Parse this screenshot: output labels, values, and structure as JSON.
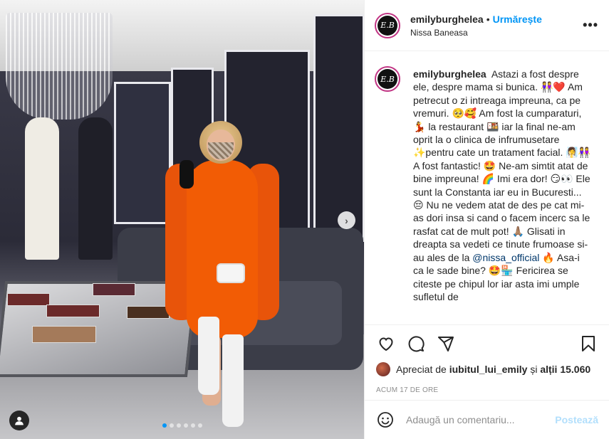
{
  "post": {
    "username": "emilyburghelea",
    "avatar_initials": "E.B",
    "follow_label": "Urmărește",
    "separator": "•",
    "location": "Nissa Baneasa",
    "more_label": "•••",
    "caption": {
      "username": "emilyburghelea",
      "segments": [
        "Astazi a fost despre ele, despre mama si bunica. 👭❤️ Am petrecut o zi intreaga impreuna, ca pe vremuri. 🥺🥰 Am fost la cumparaturi, 💃 la restaurant 🍱 iar la final ne-am oprit la o clinica de infrumusetare ✨pentru cate un tratament facial. 🧖‍♀️👭 A fost fantastic! 🤩 Ne-am simtit atat de bine impreuna! 🌈 Imi era dor! 😏👀 Ele sunt la Constanta iar eu in Bucuresti... 😔 Nu ne vedem atat de des pe cat mi-as dori insa si cand o facem incerc sa le rasfat cat de mult pot! 🙏🏽 Glisati in dreapta sa vedeti ce tinute frumoase si-au ales de la ",
        "@nissa_official",
        " 🔥 Asa-i ca le sade bine? 🤩🏪 Fericirea se citeste pe chipul lor iar asta imi umple sufletul de"
      ]
    },
    "likes": {
      "prefix": "Apreciat de",
      "liker": "iubitul_lui_emily",
      "middle": "și",
      "others": "alții 15.060"
    },
    "timestamp": "ACUM 17 DE ORE",
    "comment_box": {
      "placeholder": "Adaugă un comentariu...",
      "post_label": "Postează"
    },
    "carousel": {
      "next_label": "›",
      "slide_count": 6,
      "active_index": 0
    }
  },
  "colors": {
    "accent": "#0095f6",
    "dress": "#f25c05",
    "text": "#262626",
    "muted": "#8e8e8e"
  },
  "icons": [
    "heart-icon",
    "comment-icon",
    "share-icon",
    "bookmark-icon",
    "emoji-icon",
    "user-tag-icon",
    "chevron-right-icon",
    "more-options-icon"
  ]
}
